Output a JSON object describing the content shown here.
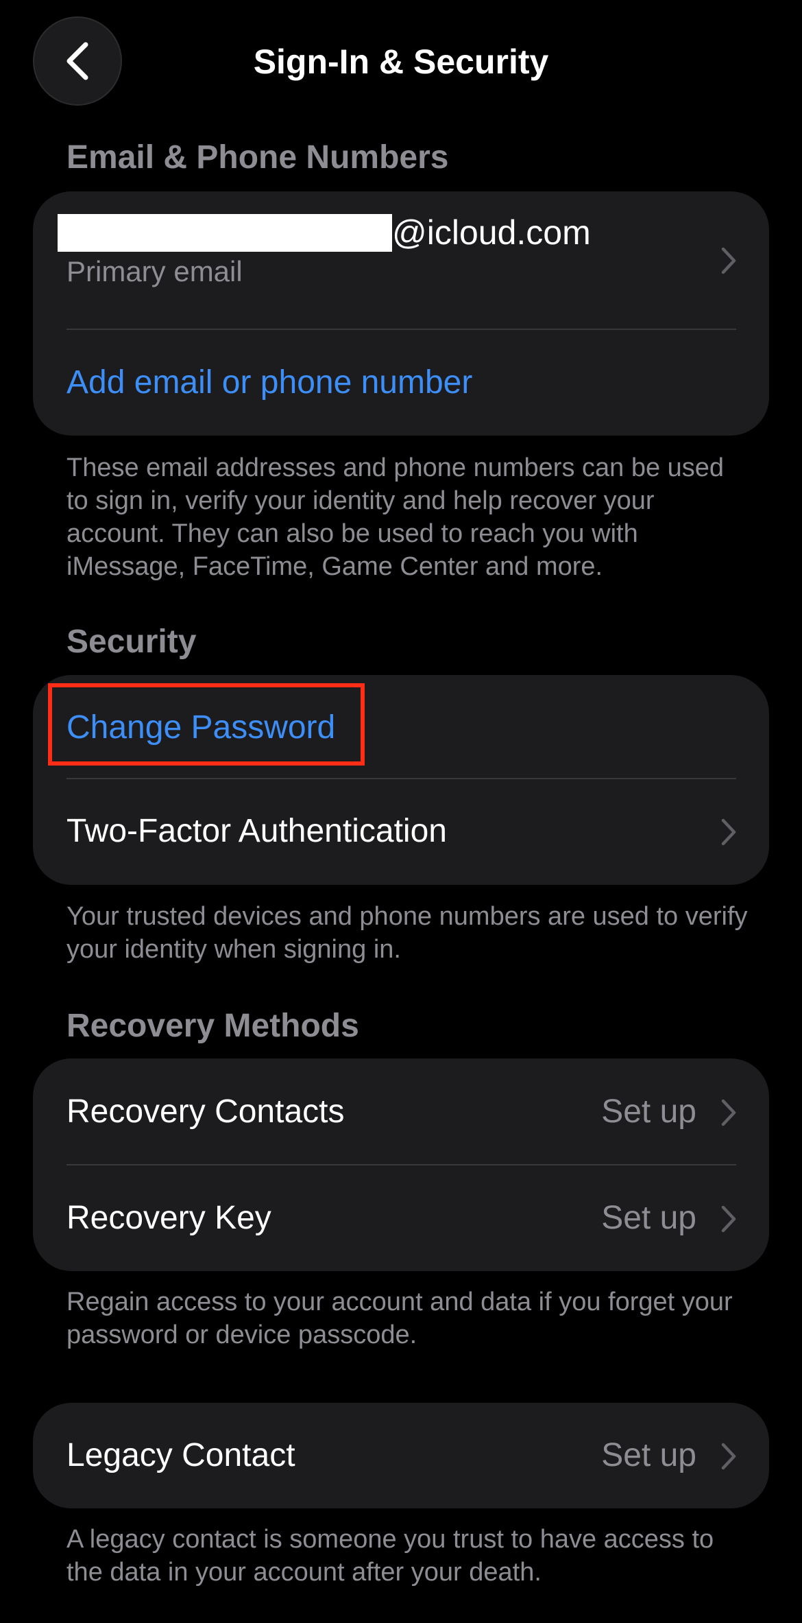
{
  "nav": {
    "title": "Sign-In & Security",
    "back_icon": "chevron-left-icon"
  },
  "email_section": {
    "header": "Email & Phone Numbers",
    "primary_email_suffix": "@icloud.com",
    "primary_email_label": "Primary email",
    "add_label": "Add email or phone number",
    "footer": "These email addresses and phone numbers can be used to sign in, verify your identity and help recover your account. They can also be used to reach you with iMessage, FaceTime, Game Center and more."
  },
  "security_section": {
    "header": "Security",
    "change_password_label": "Change Password",
    "two_factor_label": "Two-Factor Authentication",
    "footer": "Your trusted devices and phone numbers are used to verify your identity when signing in."
  },
  "recovery_section": {
    "header": "Recovery Methods",
    "items": [
      {
        "label": "Recovery Contacts",
        "value": "Set up"
      },
      {
        "label": "Recovery Key",
        "value": "Set up"
      }
    ],
    "footer": "Regain access to your account and data if you forget your password or device passcode."
  },
  "legacy_section": {
    "label": "Legacy Contact",
    "value": "Set up",
    "footer": "A legacy contact is someone you trust to have access to the data in your account after your death."
  },
  "colors": {
    "background": "#000000",
    "card": "#1c1c1e",
    "link": "#3d8ef7",
    "secondary_text": "#8d8d93",
    "highlight": "#ff2d16"
  }
}
